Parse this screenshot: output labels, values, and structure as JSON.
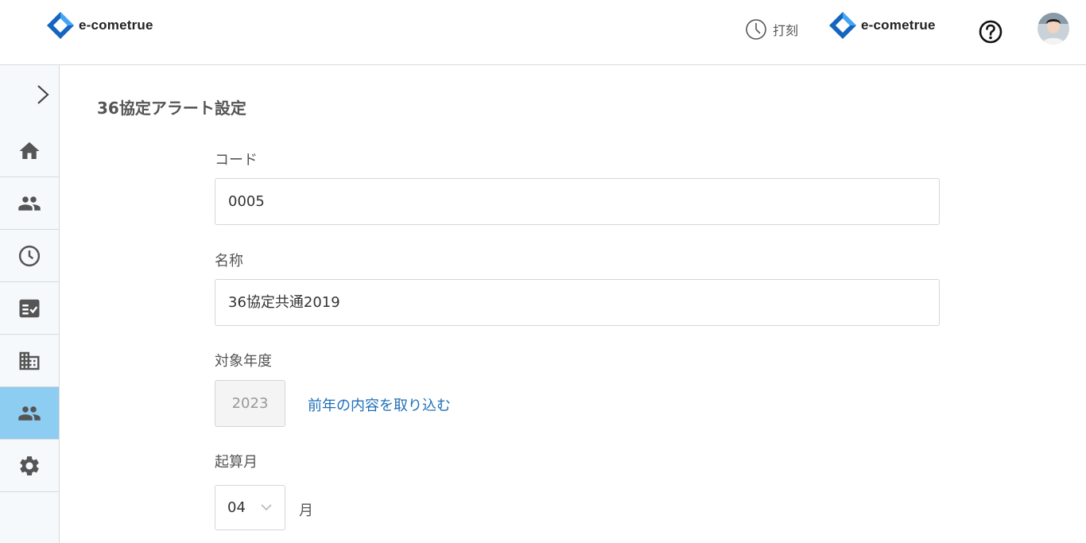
{
  "header": {
    "brand_left": "e-cometrue",
    "brand_right": "e-cometrue",
    "punch_label": "打刻",
    "help_icon": "question-circle-icon",
    "avatar_icon": "user-avatar"
  },
  "sidebar": {
    "toggle_icon": "chevron-right-icon",
    "items": [
      {
        "icon": "home-icon",
        "active": false
      },
      {
        "icon": "people-icon",
        "active": false
      },
      {
        "icon": "clock-icon",
        "active": false
      },
      {
        "icon": "checklist-icon",
        "active": false
      },
      {
        "icon": "building-icon",
        "active": false
      },
      {
        "icon": "people-icon",
        "active": true
      },
      {
        "icon": "gear-icon",
        "active": false
      }
    ]
  },
  "main": {
    "title": "36協定アラート設定",
    "code": {
      "label": "コード",
      "value": "0005"
    },
    "name": {
      "label": "名称",
      "value": "36協定共通2019"
    },
    "target_year": {
      "label": "対象年度",
      "value": "2023",
      "import_link": "前年の内容を取り込む"
    },
    "start_month": {
      "label": "起算月",
      "value": "04",
      "unit": "月"
    }
  },
  "colors": {
    "accent_blue": "#1e6fb8",
    "logo_blue": "#1565c0",
    "sidebar_active": "#8dcdf2",
    "sidebar_bg": "#f6f9fc"
  }
}
